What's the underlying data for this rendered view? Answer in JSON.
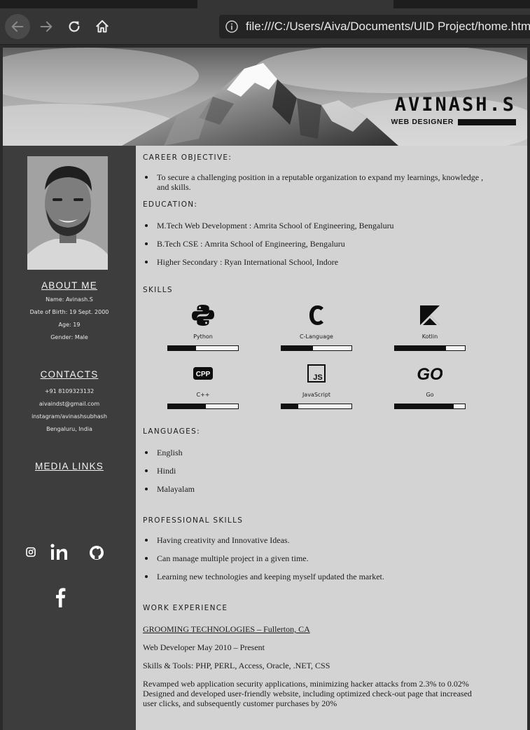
{
  "browser": {
    "url": "file:///C:/Users/Aiva/Documents/UID Project/home.html"
  },
  "header": {
    "name": "AVINASH.S",
    "role": "WEB DESIGNER"
  },
  "sidebar": {
    "about_title": "ABOUT ME",
    "about_lines": [
      "Name: Avinash.S",
      "Date of Birth: 19 Sept. 2000",
      "Age: 19",
      "Gender: Male"
    ],
    "contacts_title": "CONTACTS",
    "contact_lines": [
      "+91 8109323132",
      "aivaindst@gmail.com",
      "instagram/avinashsubhash",
      "Bengaluru, India"
    ],
    "media_title": "MEDIA LINKS",
    "media_icons": [
      "instagram-icon",
      "linkedin-icon",
      "github-icon",
      "facebook-icon"
    ]
  },
  "career": {
    "title": "CAREER OBJECTIVE:",
    "items": [
      "To secure a challenging position in a reputable organization to expand my learnings, knowledge , and skills."
    ]
  },
  "education": {
    "title": "EDUCATION:",
    "items": [
      "M.Tech Web Development : Amrita School of Engineering, Bengaluru",
      "B.Tech CSE : Amrita School of Engineering, Bengaluru",
      "Higher Secondary : Ryan International School, Indore"
    ]
  },
  "skills": {
    "title": "SKILLS",
    "items": [
      {
        "name": "Python",
        "icon": "python-icon",
        "level": 0.4
      },
      {
        "name": "C-Language",
        "icon": "c-language-icon",
        "level": 0.45
      },
      {
        "name": "Kotlin",
        "icon": "kotlin-icon",
        "level": 0.73
      },
      {
        "name": "C++",
        "icon": "cpp-icon",
        "level": 0.54
      },
      {
        "name": "JavaScript",
        "icon": "javascript-icon",
        "level": 0.24
      },
      {
        "name": "Go",
        "icon": "go-icon",
        "level": 0.84
      }
    ]
  },
  "languages": {
    "title": "LANGUAGES:",
    "items": [
      "English",
      "Hindi",
      "Malayalam"
    ]
  },
  "professional": {
    "title": "PROFESSIONAL SKILLS",
    "items": [
      "Having creativity and Innovative Ideas.",
      "Can manage multiple project in a given time.",
      "Learning new technologies and keeping myself updated the market."
    ]
  },
  "work": {
    "title": "WORK EXPERIENCE",
    "job_title": "GROOMING TECHNOLOGIES – Fullerton, CA",
    "position": "Web Developer May 2010 – Present",
    "tools": "Skills & Tools: PHP, PERL, Access, Oracle, .NET, CSS",
    "description": "Revamped web application security applications, minimizing hacker attacks from 2.3% to 0.02% Designed and developed user-friendly website, including optimized check-out page that increased user clicks, and subsequently customer purchases by 20%"
  }
}
